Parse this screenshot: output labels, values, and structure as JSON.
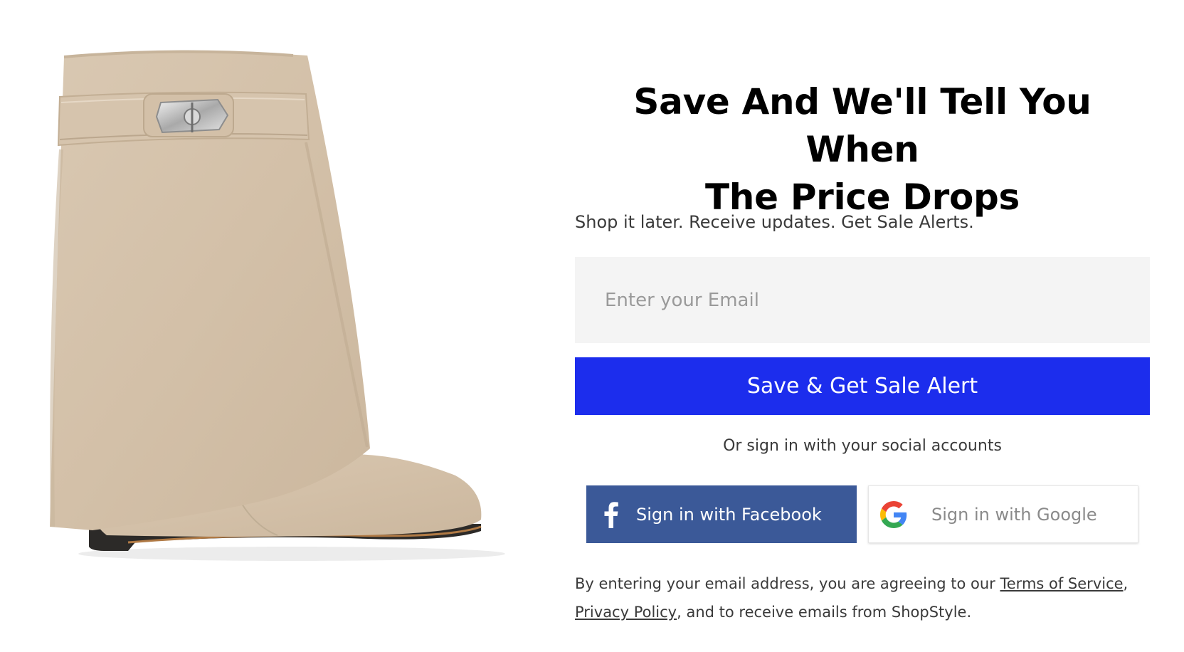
{
  "modal": {
    "title_line1": "Save And We'll Tell You When",
    "title_line2": "The Price Drops",
    "subtitle": "Shop it later. Receive updates. Get Sale Alerts.",
    "email_placeholder": "Enter your Email",
    "email_value": "",
    "save_button_label": "Save & Get Sale Alert",
    "social_caption": "Or sign in with your social accounts",
    "facebook_button_label": "Sign in with Facebook",
    "google_button_label": "Sign in with Google",
    "legal": {
      "prefix": "By entering your email address, you are agreeing to our ",
      "terms_link": "Terms of Service",
      "comma": ",",
      "privacy_link": "Privacy Policy",
      "suffix": ", and to receive emails from ShopStyle."
    }
  },
  "product": {
    "image": "beige-suede-wedge-boot"
  },
  "icons": {
    "facebook": "facebook-icon",
    "google": "google-icon"
  },
  "colors": {
    "primary_button": "#1c2ded",
    "facebook_blue": "#3b5998",
    "input_background": "#f4f4f4",
    "boot_suede": "#d8c6af"
  }
}
